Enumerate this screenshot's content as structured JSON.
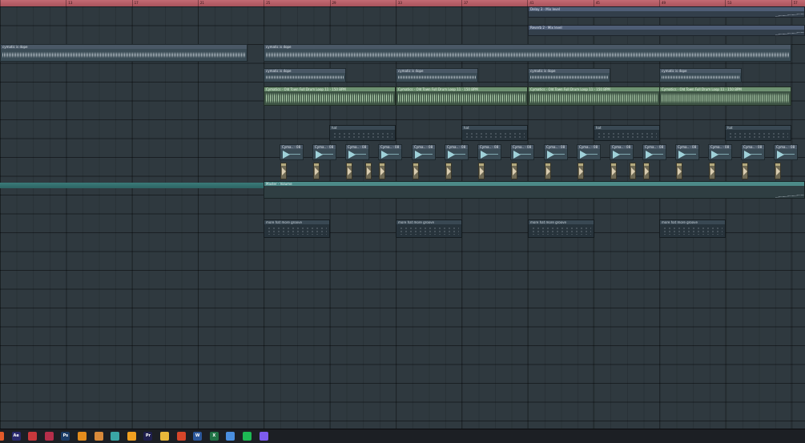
{
  "ruler": {
    "bars": [
      "",
      "13",
      "17",
      "21",
      "25",
      "29",
      "33",
      "37",
      "41",
      "45",
      "49",
      "53",
      "57"
    ]
  },
  "clips": {
    "delay_auto": "Delay 3 - Mix level",
    "reverb_auto": "Reverb 2 - Mix level",
    "cymatic": "cymatic is dope",
    "drum_loop": "Cymatics - Old Town Full Drum Loop 11 - 150 BPM",
    "hat": "hat",
    "cyma": "Cyma.. - 08",
    "master_auto": "Master - Volume",
    "hat_groove": "more hat more groove"
  },
  "taskbar": {
    "icons": [
      {
        "name": "firefox",
        "color": "#e25b2a",
        "label": ""
      },
      {
        "name": "after-effects",
        "color": "#2a2a6e",
        "label": "Ae"
      },
      {
        "name": "app-red",
        "color": "#c8383c",
        "label": ""
      },
      {
        "name": "app-red2",
        "color": "#b52e4a",
        "label": ""
      },
      {
        "name": "photoshop",
        "color": "#1b3c67",
        "label": "Ps"
      },
      {
        "name": "blender",
        "color": "#e48c1c",
        "label": ""
      },
      {
        "name": "app-orange",
        "color": "#d98a3a",
        "label": ""
      },
      {
        "name": "app-teal",
        "color": "#3aa5a5",
        "label": ""
      },
      {
        "name": "fl-studio",
        "color": "#f0a020",
        "label": ""
      },
      {
        "name": "premiere",
        "color": "#1f1f4e",
        "label": "Pr"
      },
      {
        "name": "file-explorer",
        "color": "#e8b83a",
        "label": ""
      },
      {
        "name": "office",
        "color": "#d6462a",
        "label": ""
      },
      {
        "name": "word",
        "color": "#2b579a",
        "label": "W"
      },
      {
        "name": "excel",
        "color": "#217346",
        "label": "X"
      },
      {
        "name": "app-blue",
        "color": "#4a8fe0",
        "label": ""
      },
      {
        "name": "spotify",
        "color": "#1db954",
        "label": ""
      },
      {
        "name": "discord",
        "color": "#7d5cf0",
        "label": ""
      }
    ]
  }
}
